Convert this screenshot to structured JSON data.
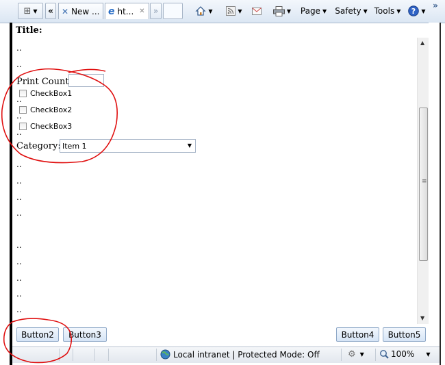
{
  "toolbar": {
    "back_label": "«",
    "tab1_label": "New ...",
    "tab2_label": "ht...",
    "overflow_label": "»",
    "page_label": "Page",
    "safety_label": "Safety",
    "tools_label": "Tools",
    "chevron_label": "»",
    "caret": "▼"
  },
  "form": {
    "title_label": "Title:",
    "dots": "..",
    "print_count_label": "Print Count:",
    "print_count_value": "",
    "checkboxes": [
      {
        "label": "CheckBox1",
        "checked": false
      },
      {
        "label": "CheckBox2",
        "checked": false
      },
      {
        "label": "CheckBox3",
        "checked": false
      }
    ],
    "category_label": "Category:",
    "category_value": "Item 1"
  },
  "buttons": {
    "button2": "Button2",
    "button3": "Button3",
    "button4": "Button4",
    "button5": "Button5"
  },
  "status": {
    "zone_text": "Local intranet | Protected Mode: Off",
    "zoom": "100%"
  },
  "colors": {
    "annotation": "#e01010",
    "ie_blue": "#2b6fc7"
  }
}
